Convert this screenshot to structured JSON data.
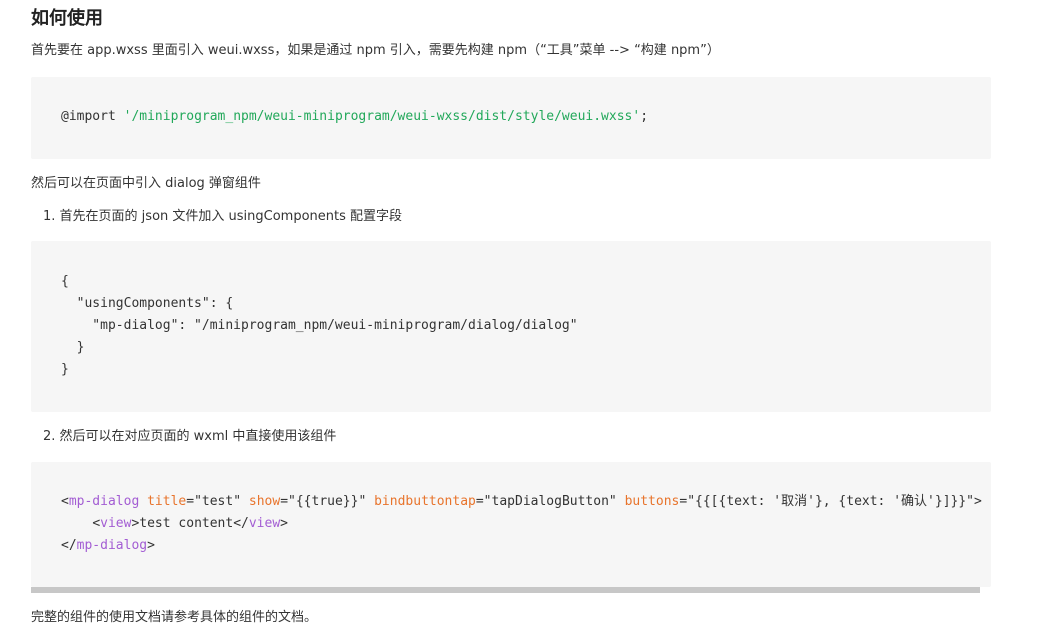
{
  "heading": "如何使用",
  "intro": "首先要在 app.wxss 里面引入 weui.wxss，如果是通过 npm 引入，需要先构建 npm（“工具”菜单 --> “构建 npm”）",
  "code1": {
    "keyword": "@import ",
    "string": "'/miniprogram_npm/weui-miniprogram/weui-wxss/dist/style/weui.wxss'",
    "end": ";"
  },
  "para2": "然后可以在页面中引入 dialog 弹窗组件",
  "step1": {
    "num": "1.",
    "text": "首先在页面的 json 文件加入 usingComponents 配置字段"
  },
  "code2": {
    "lines": [
      "{",
      "  \"usingComponents\": {",
      "    \"mp-dialog\": \"/miniprogram_npm/weui-miniprogram/dialog/dialog\"",
      "  }",
      "}"
    ]
  },
  "step2": {
    "num": "2.",
    "text": "然后可以在对应页面的 wxml 中直接使用该组件"
  },
  "code3": {
    "lt": "<",
    "gt": ">",
    "close_lt": "</",
    "tag_dialog": "mp-dialog",
    "attr_title": "title",
    "val_title": "=\"test\" ",
    "attr_show": "show",
    "val_show": "=\"{{true}}\" ",
    "attr_bind": "bindbuttontap",
    "val_bind": "=\"tapDialogButton\" ",
    "attr_buttons": "buttons",
    "val_buttons": "=\"{{[{text: '取消'}, {text: '确认'}]}}\"",
    "indent": "    ",
    "tag_view": "view",
    "view_content": "test content"
  },
  "footer": "完整的组件的使用文档请参考具体的组件的文档。"
}
